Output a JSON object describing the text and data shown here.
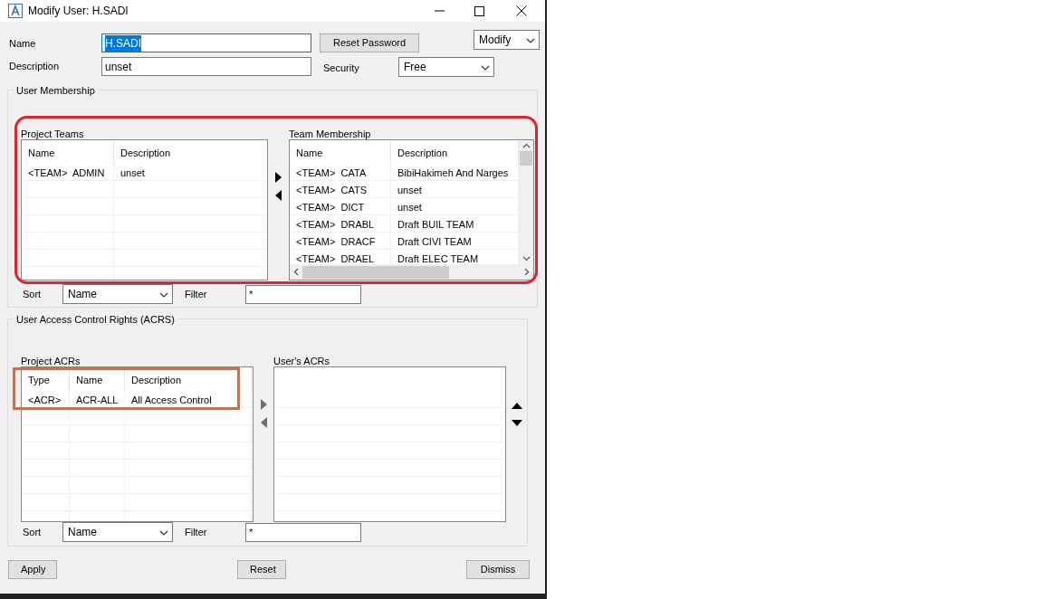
{
  "window": {
    "title": "Modify User: H.SADI"
  },
  "form": {
    "name_label": "Name",
    "name_field": {
      "value": "H.SADI",
      "selected": true
    },
    "reset_password": "Reset Password",
    "mode_dropdown": "Modify",
    "description_label": "Description",
    "description_field": {
      "value": "unset",
      "selected": false
    },
    "security_label": "Security",
    "security_dropdown": "Free"
  },
  "membership": {
    "title": "User Membership",
    "project_teams": {
      "label": "Project Teams",
      "columns": [
        "Name",
        "Description"
      ],
      "rows": [
        [
          "<TEAM>  ADMIN",
          "unset"
        ]
      ]
    },
    "team_membership": {
      "label": "Team Membership",
      "columns": [
        "Name",
        "Description"
      ],
      "rows": [
        [
          "<TEAM>  CATA",
          "BibiHakimeh And Narges"
        ],
        [
          "<TEAM>  CATS",
          "unset"
        ],
        [
          "<TEAM>  DICT",
          "unset"
        ],
        [
          "<TEAM>  DRABL",
          "Draft BUIL TEAM"
        ],
        [
          "<TEAM>  DRACF",
          "Draft CIVI TEAM"
        ],
        [
          "<TEAM>  DRAEL",
          "Draft ELEC TEAM"
        ]
      ]
    },
    "sort_label": "Sort",
    "sort_value": "Name",
    "filter_label": "Filter",
    "filter_value": "*"
  },
  "acrs": {
    "title": "User Access Control Rights (ACRS)",
    "project_acrs": {
      "label": "Project ACRs",
      "columns": [
        "Type",
        "Name",
        "Description"
      ],
      "rows": [
        [
          "<ACR>",
          "ACR-ALL",
          "All Access Control"
        ]
      ]
    },
    "users_acrs": {
      "label": "User's ACRs"
    },
    "sort_label": "Sort",
    "sort_value": "Name",
    "filter_label": "Filter",
    "filter_value": "*"
  },
  "buttons": [
    "Apply",
    "Reset",
    "Dismiss"
  ]
}
